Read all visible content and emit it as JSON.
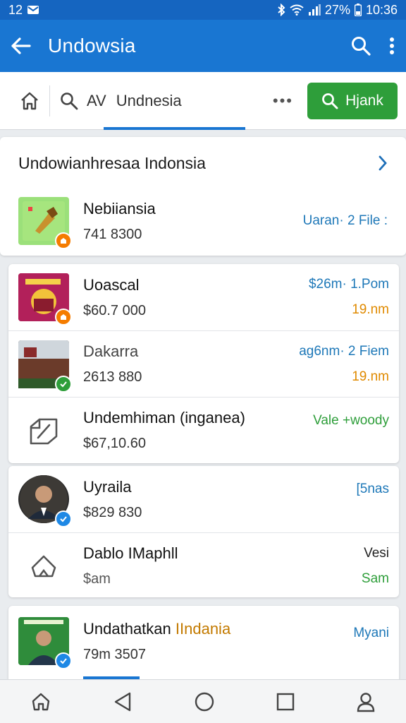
{
  "status_bar": {
    "time": "12",
    "battery": "27%",
    "clock": "10:36"
  },
  "app_bar": {
    "title": "Undowsia"
  },
  "search_row": {
    "query_prefix": "AV",
    "active_tab": "Undnesia",
    "more": "•••",
    "action_label": "Hjank"
  },
  "section": {
    "title": "Undowianhresaa Indonsia",
    "item": {
      "name": "Nebiiansia",
      "sub": "741 8300",
      "meta": "Uaran· 2 File :"
    }
  },
  "group1": {
    "items": [
      {
        "name": "Uoascal",
        "sub": "$60.7 000",
        "meta1": "$26m· 1.Pom",
        "meta2": "19.nm"
      },
      {
        "name": "Dakarra",
        "sub": "2613 880",
        "meta1": "ag6nm· 2 Fiem",
        "meta2": "19.nm"
      },
      {
        "name": "Undemhiman (inganea)",
        "sub": "$67,10.60",
        "meta1": "Vale +woody"
      }
    ]
  },
  "group2": {
    "items": [
      {
        "name": "Uyraila",
        "sub": "$829 830",
        "meta1": "[5nas"
      },
      {
        "name": "Dablo IMaphll",
        "sub": "$am",
        "meta1": "Vesi",
        "meta2": "Sam"
      }
    ]
  },
  "group3": {
    "item": {
      "name_a": "Undathatkan",
      "name_b": "IIndania",
      "sub": "79m 3507",
      "meta1": "Myani"
    }
  }
}
